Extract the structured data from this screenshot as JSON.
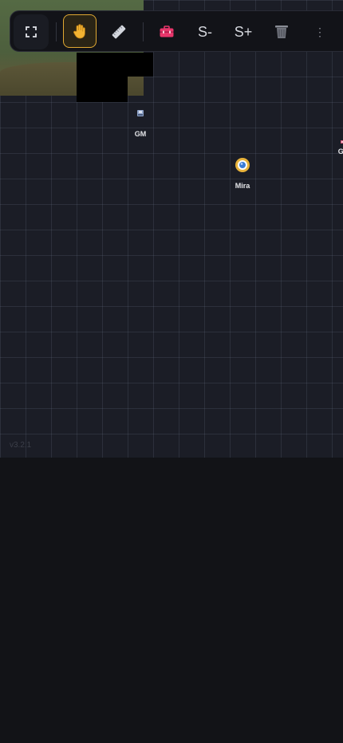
{
  "toolbar": {
    "fullscreen_icon": "fullscreen-icon",
    "hand_icon": "hand-icon",
    "ruler_icon": "ruler-icon",
    "toolbox_icon": "toolbox-icon",
    "size_down_label": "S-",
    "size_up_label": "S+",
    "trash_icon": "trash-icon",
    "more_label": "⋮",
    "active_tool": "hand",
    "accent_color": "#e0a832"
  },
  "tokens": [
    {
      "label": "GM"
    },
    {
      "label": "Mira"
    },
    {
      "label": "Go"
    }
  ],
  "version": "v3.2.1",
  "colors": {
    "map_bg": "#1b1d26",
    "page_bg": "#121317",
    "toolbox_pink": "#e8366b"
  }
}
